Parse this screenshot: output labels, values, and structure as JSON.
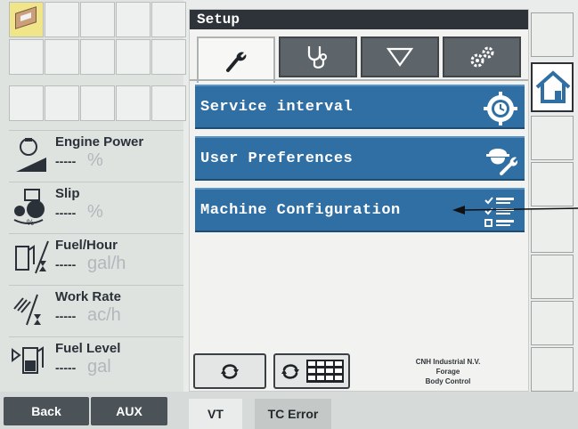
{
  "setup": {
    "title": "Setup",
    "tabs": [
      {
        "icon": "wrench-icon",
        "active": true
      },
      {
        "icon": "stethoscope-icon",
        "active": false
      },
      {
        "icon": "triangle-down-icon",
        "active": false
      },
      {
        "icon": "gears-icon",
        "active": false
      }
    ],
    "menu": [
      {
        "label": "Service interval",
        "icon": "service-clock-gear-icon"
      },
      {
        "label": "User Preferences",
        "icon": "user-wrench-icon"
      },
      {
        "label": "Machine Configuration",
        "icon": "checklist-icon"
      }
    ],
    "footer": {
      "brand_line1": "CNH Industrial N.V.",
      "brand_line2": "Forage",
      "brand_line3": "Body Control"
    }
  },
  "gauges": [
    {
      "title": "Engine Power",
      "value": "-----",
      "unit": "%",
      "icon": "engine-power-icon"
    },
    {
      "title": "Slip",
      "value": "-----",
      "unit": "%",
      "icon": "tractor-slip-icon"
    },
    {
      "title": "Fuel/Hour",
      "value": "-----",
      "unit": "gal/h",
      "icon": "fuel-hour-icon"
    },
    {
      "title": "Work Rate",
      "value": "-----",
      "unit": "ac/h",
      "icon": "work-rate-icon"
    },
    {
      "title": "Fuel Level",
      "value": "-----",
      "unit": "gal",
      "icon": "fuel-level-icon"
    }
  ],
  "bottom": {
    "back": "Back",
    "aux": "AUX",
    "vt": "VT",
    "tc_error": "TC Error"
  },
  "colors": {
    "menu_blue": "#2f6fa4",
    "title_bar": "#2d3339",
    "tab_dark": "#5d646a"
  }
}
